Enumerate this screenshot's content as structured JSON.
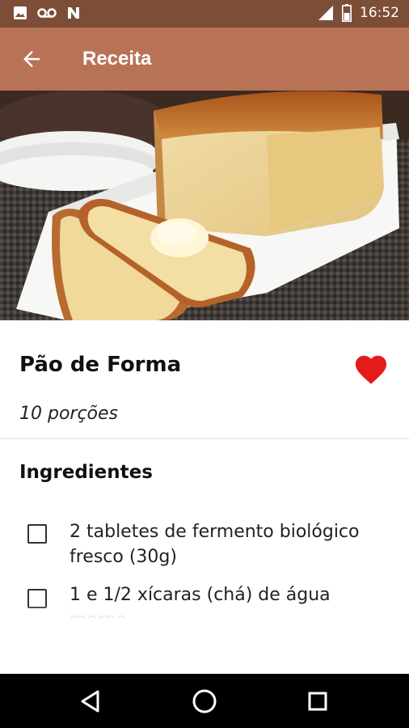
{
  "status_bar": {
    "time": "16:52",
    "icons": [
      "image-icon",
      "voicemail-icon",
      "no-signal-icon",
      "signal-icon",
      "battery-icon"
    ]
  },
  "app_bar": {
    "title": "Receita",
    "back_icon": "arrow-left-icon"
  },
  "recipe": {
    "name": "Pão de Forma",
    "servings": "10 porções",
    "favorite": true,
    "favorite_color": "#e31b1b",
    "image": "bread-loaf-photo"
  },
  "ingredients": {
    "heading": "Ingredientes",
    "items": [
      {
        "line1": "2 tabletes de fermento biológico",
        "line2": "fresco (30g)",
        "checked": false
      },
      {
        "line1": "1 e 1/2 xícaras (chá) de água",
        "line2": "morna",
        "checked": false
      }
    ]
  },
  "nav_bar": {
    "buttons": [
      "back-triangle-icon",
      "home-circle-icon",
      "recents-square-icon"
    ]
  },
  "colors": {
    "status_bar": "#7d4e37",
    "app_bar": "#b87357",
    "accent_heart": "#e31b1b"
  }
}
